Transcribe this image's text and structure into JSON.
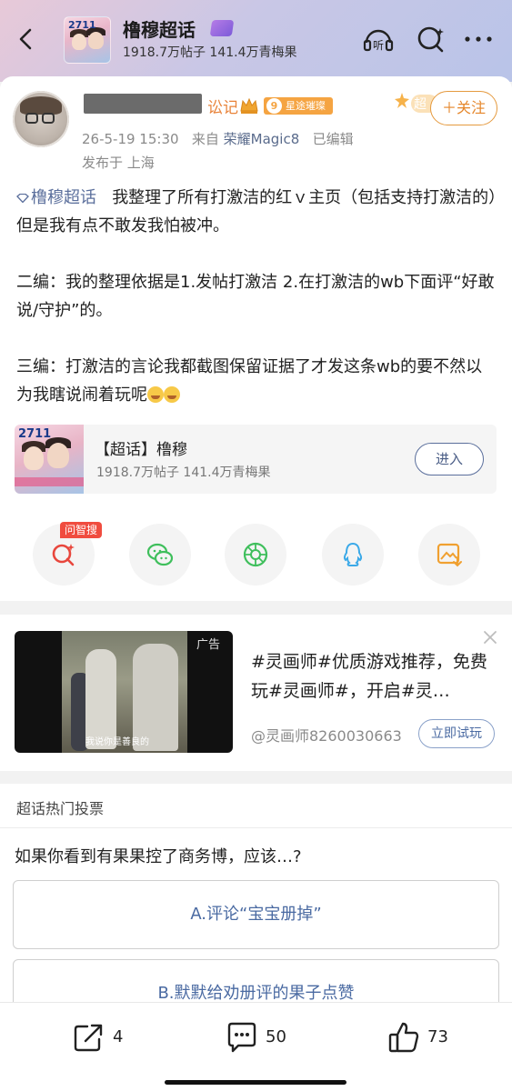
{
  "header": {
    "super_topic_name": "橹穆超话",
    "stats": "1918.7万帖子  141.4万青梅果"
  },
  "post": {
    "author_suffix": "讼记",
    "level": "9",
    "level_label": "星途璀璨",
    "follow_label": "＋关注",
    "deco_label": "超",
    "date": "26-5-19 15:30",
    "source_prefix": "来自",
    "device": "荣耀Magic8",
    "edited": "已编辑",
    "location": "发布于 上海",
    "topic_link": "橹穆超话",
    "paragraph1": "我整理了所有打激洁的红ｖ主页（包括支持打激洁的）但是我有点不敢发我怕被冲。",
    "paragraph2": "二编：我的整理依据是1.发帖打激洁 2.在打激洁的wb下面评“好敢说/守护”的。",
    "paragraph3": "三编：打激洁的言论我都截图保留证据了才发这条wb的要不然以为我瞎说闹着玩呢"
  },
  "super_topic_card": {
    "title": "【超话】橹穆",
    "stats": "1918.7万帖子  141.4万青梅果",
    "enter_label": "进入",
    "cover_number": "2711"
  },
  "share": {
    "ask_tag": "问智搜",
    "items": [
      "ask-search",
      "wechat",
      "moments",
      "qq",
      "save-image"
    ]
  },
  "ad": {
    "label": "广告",
    "text": "#灵画师#优质游戏推荐，免费玩#灵画师#，开启#灵…",
    "source": "@灵画师8260030663",
    "try_label": "立即试玩",
    "video_caption": "我说你是善良的"
  },
  "vote": {
    "section_title": "超话热门投票",
    "question": "如果你看到有果果控了商务博，应该…?",
    "options": [
      "A.评论“宝宝册掉”",
      "B.默默给劝册评的果子点赞"
    ]
  },
  "actions": {
    "reposts": "4",
    "comments": "50",
    "likes": "73"
  },
  "colors": {
    "link_blue": "#5b6f9c",
    "follow_orange": "#e5862a",
    "badge_orange": "#f5a442",
    "ask_red": "#f04c3f"
  }
}
